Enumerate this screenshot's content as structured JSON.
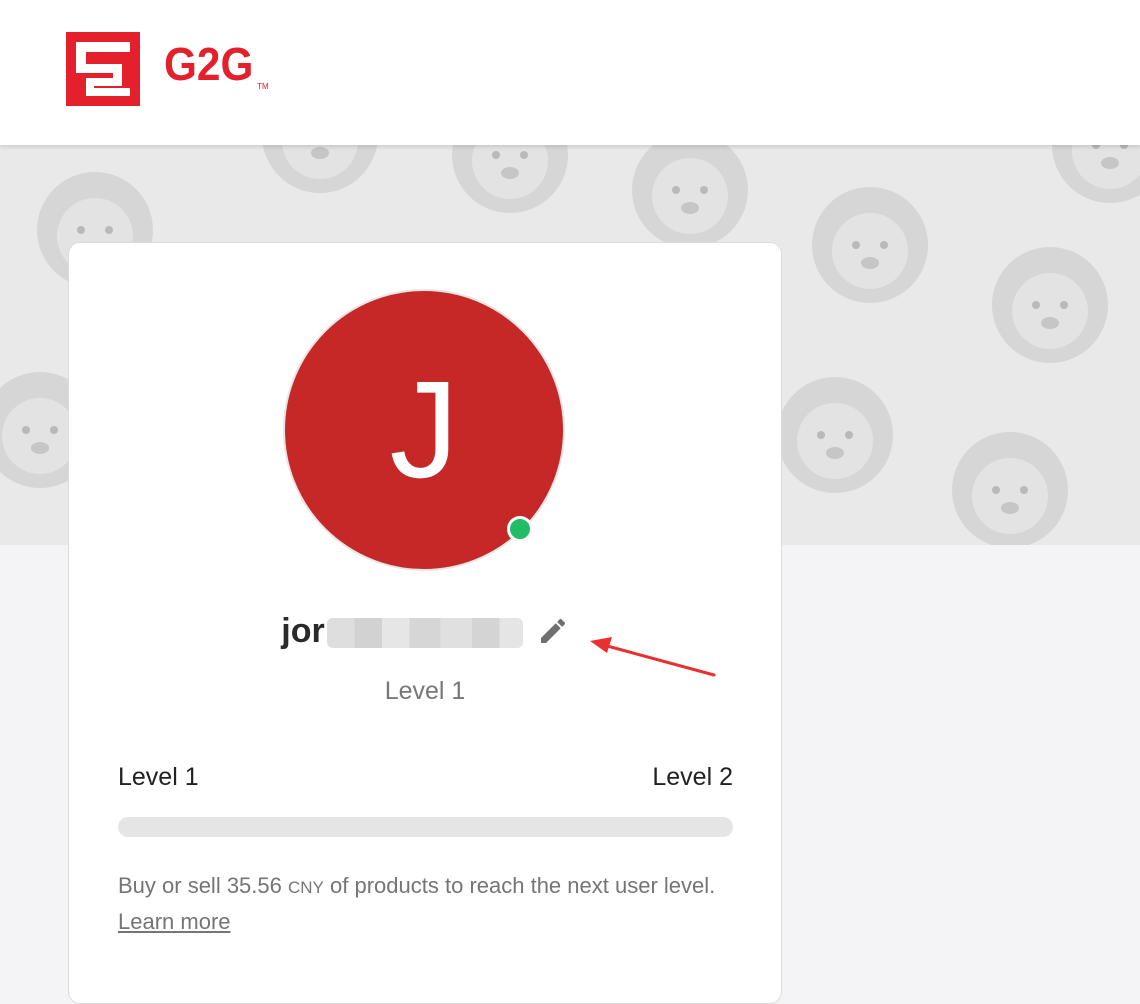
{
  "header": {
    "brand": "G2G",
    "trademark": "TM"
  },
  "profile": {
    "avatar_initial": "J",
    "username_visible": "jor",
    "status": "online",
    "level_label": "Level 1"
  },
  "progress": {
    "current_level": "Level 1",
    "next_level": "Level 2",
    "fraction": 0,
    "message_prefix": "Buy or sell 35.56",
    "currency": "CNY",
    "message_suffix": "of products to reach the next user level.",
    "learn_more": "Learn more"
  },
  "colors": {
    "brand": "#e4202c",
    "avatar_bg": "#c62828",
    "online": "#22bb66",
    "annotation": "#e8302e"
  },
  "icons": {
    "edit": "pencil-icon",
    "logo": "g2g-logo-icon"
  }
}
